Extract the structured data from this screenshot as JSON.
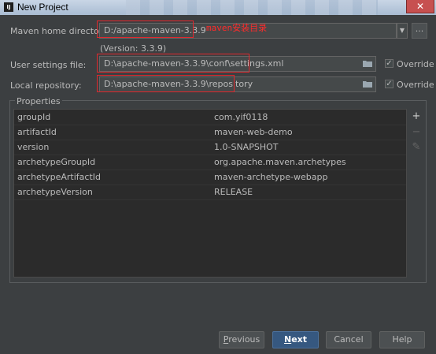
{
  "window": {
    "title": "New Project",
    "app_icon_text": "IJ"
  },
  "maven_home": {
    "label": "Maven home directory:",
    "value": "D:/apache-maven-3.3.9",
    "annotation": "maven安装目录",
    "version": "(Version: 3.3.9)",
    "browse_label": "..."
  },
  "user_settings": {
    "label": "User settings file:",
    "value": "D:\\apache-maven-3.3.9\\conf\\settings.xml",
    "override_label": "Override",
    "override_checked": true
  },
  "local_repo": {
    "label": "Local repository:",
    "value": "D:\\apache-maven-3.3.9\\repository",
    "override_label": "Override",
    "override_checked": true
  },
  "properties": {
    "title": "Properties",
    "rows": [
      {
        "key": "groupId",
        "value": "com.yif0118"
      },
      {
        "key": "artifactId",
        "value": "maven-web-demo"
      },
      {
        "key": "version",
        "value": "1.0-SNAPSHOT"
      },
      {
        "key": "archetypeGroupId",
        "value": "org.apache.maven.archetypes"
      },
      {
        "key": "archetypeArtifactId",
        "value": "maven-archetype-webapp"
      },
      {
        "key": "archetypeVersion",
        "value": "RELEASE"
      }
    ],
    "add_glyph": "+",
    "remove_glyph": "−",
    "edit_glyph": "✎"
  },
  "buttons": {
    "previous_mnemonic": "P",
    "previous_rest": "revious",
    "next_mnemonic": "N",
    "next_rest": "ext",
    "cancel": "Cancel",
    "help": "Help"
  },
  "colors": {
    "accent": "#365880",
    "annotation_red": "#e0282d",
    "background": "#3c3f41"
  }
}
